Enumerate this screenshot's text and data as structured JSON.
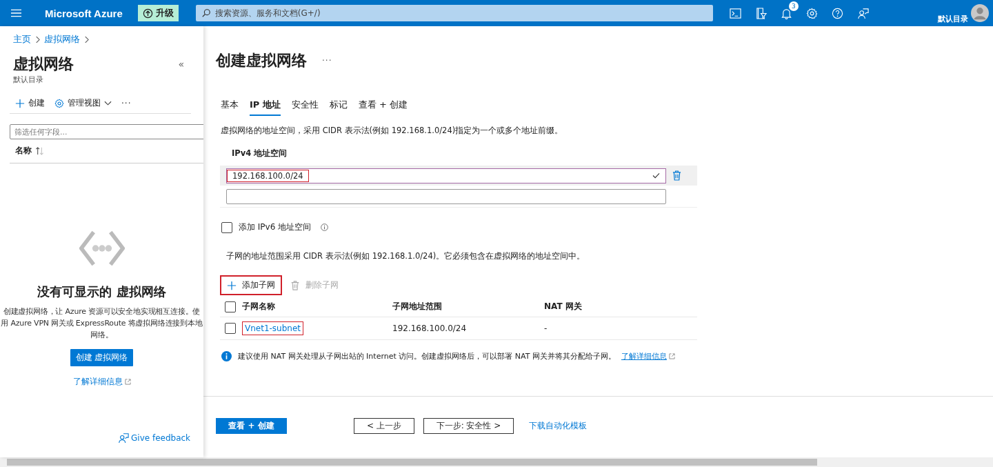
{
  "topbar": {
    "brand": "Microsoft Azure",
    "upgrade_label": "升级",
    "search_placeholder": "搜索资源、服务和文档(G+/)",
    "notification_count": "3",
    "directory": "默认目录"
  },
  "breadcrumb": [
    "主页",
    "虚拟网络"
  ],
  "left_panel": {
    "title": "虚拟网络",
    "subtitle": "默认目录",
    "collapse": "«",
    "toolbar": [
      {
        "kind": "create",
        "label": "创建"
      },
      {
        "kind": "view",
        "label": "管理视图"
      },
      {
        "kind": "more",
        "label": "···"
      }
    ],
    "filter_placeholder": "筛选任何字段...",
    "column_header": "名称",
    "empty_title": "没有可显示的 虚拟网络",
    "empty_description": "创建虚拟网络，让 Azure 资源可以安全地实现相互连接。使用 Azure VPN 网关或 ExpressRoute 将虚拟网络连接到本地网络。",
    "create_button": "创建 虚拟网络",
    "learn_more": "了解详细信息",
    "feedback": "Give feedback"
  },
  "main": {
    "title": "创建虚拟网络",
    "more": "···",
    "tabs": [
      {
        "label": "基本",
        "selected": false
      },
      {
        "label": "IP 地址",
        "selected": true
      },
      {
        "label": "安全性",
        "selected": false
      },
      {
        "label": "标记",
        "selected": false
      },
      {
        "label": "查看 + 创建",
        "selected": false
      }
    ],
    "description": "虚拟网络的地址空间，采用 CIDR 表示法(例如 192.168.1.0/24)指定为一个或多个地址前缀。",
    "ipv4_label": "IPv4 地址空间",
    "address": {
      "value": "192.168.100.0/24",
      "valid": true,
      "highlighted": true
    },
    "ipv6": {
      "label": "添加 IPv6 地址空间",
      "checked": false
    },
    "subnet_description": "子网的地址范围采用 CIDR 表示法(例如 192.168.1.0/24)。它必须包含在虚拟网络的地址空间中。",
    "add_subnet": {
      "label": "添加子网",
      "highlighted": true
    },
    "delete_subnet": {
      "label": "删除子网",
      "disabled": true
    },
    "select_all": {
      "checked": false
    },
    "columns": [
      "子网名称",
      "子网地址范围",
      "NAT 网关"
    ],
    "rows": [
      {
        "name": "Vnet1-subnet",
        "range": "192.168.100.0/24",
        "nat": "-",
        "selected": false,
        "highlighted": true
      }
    ],
    "info": "建议使用 NAT 网关处理从子网出站的 Internet 访问。创建虚拟网络后，可以部署 NAT 网关并将其分配给子网。",
    "info_link": "了解详细信息"
  },
  "footer": {
    "primary": "查看 + 创建",
    "previous": "< 上一步",
    "next": "下一步: 安全性 >",
    "template": "下载自动化模板"
  }
}
